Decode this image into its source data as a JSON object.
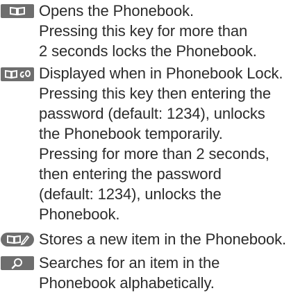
{
  "entries": [
    {
      "icon": "phonebook-key-icon",
      "lines": [
        "Opens the Phonebook.",
        "Pressing this key for more than",
        "2 seconds locks the Phonebook."
      ]
    },
    {
      "icon": "phonebook-lock-key-icon",
      "lines": [
        "Displayed when in Phonebook Lock.",
        "Pressing this key then entering the",
        "password (default: 1234), unlocks",
        "the Phonebook temporarily.",
        "Pressing for more than 2 seconds,",
        "then entering the password",
        "(default: 1234), unlocks the",
        "Phonebook."
      ]
    },
    {
      "icon": "store-item-key-icon",
      "lines": [
        "Stores a new item in the Phonebook."
      ]
    },
    {
      "icon": "search-key-icon",
      "lines": [
        "Searches for an item in the",
        "Phonebook alphabetically."
      ]
    }
  ],
  "colors": {
    "text": "#2b2b2b",
    "key_fill": "#6e6e6e"
  }
}
